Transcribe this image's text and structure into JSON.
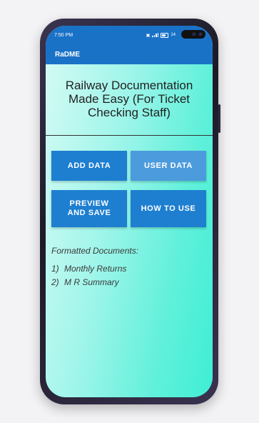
{
  "status_bar": {
    "time": "7:50 PM",
    "battery_text": "14"
  },
  "app_bar": {
    "title": "RaDME"
  },
  "main": {
    "title": "Railway Documentation Made Easy (For Ticket Checking Staff)",
    "buttons": [
      {
        "label": "ADD DATA"
      },
      {
        "label": "USER DATA"
      },
      {
        "label": "PREVIEW AND SAVE"
      },
      {
        "label": "HOW TO USE"
      }
    ],
    "documents": {
      "heading": "Formatted Documents:",
      "items": [
        {
          "num": "1)",
          "label": "Monthly Returns"
        },
        {
          "num": "2)",
          "label": "M R Summary"
        }
      ]
    }
  },
  "colors": {
    "primary": "#1a72c7",
    "button": "#1e7fd0",
    "button_light": "#4c9bdc",
    "accent": "#3feed5"
  }
}
